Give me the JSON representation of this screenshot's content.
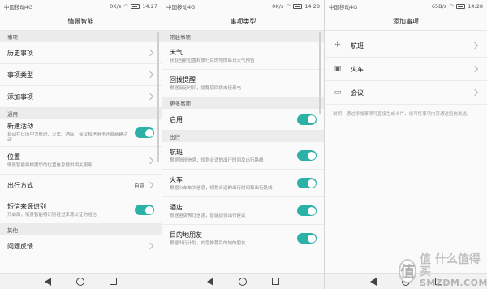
{
  "panels": [
    {
      "status": {
        "carrier": "中国移动4G",
        "speed": "0K/s",
        "time": "14:27",
        "battery_level": 0.75
      },
      "title": "情景智能",
      "sections": [
        {
          "header": "事项",
          "rows": [
            {
              "label": "历史事项",
              "control": "chevron"
            },
            {
              "label": "事项类型",
              "control": "chevron"
            },
            {
              "label": "添加事项",
              "control": "chevron"
            }
          ]
        },
        {
          "header": "通用",
          "rows": [
            {
              "label": "新建活动",
              "sub": "自动在日历中为航班、火车、酒店、会议和信用卡还款新建活动",
              "control": "toggle",
              "on": true
            },
            {
              "label": "位置",
              "sub": "情景智能将根据您的位置信息提供相关服务",
              "control": "chevron"
            },
            {
              "label": "出行方式",
              "value": "自驾",
              "control": "chevron"
            },
            {
              "label": "短信来源识别",
              "sub": "开启后，情景智能将识别经过来源认证的短信",
              "control": "toggle",
              "on": true
            }
          ]
        },
        {
          "header": "其他",
          "rows": [
            {
              "label": "问题反馈",
              "control": "chevron"
            }
          ]
        }
      ]
    },
    {
      "status": {
        "carrier": "中国移动4G",
        "speed": "0K/s",
        "time": "14:28",
        "battery_level": 0.75
      },
      "title": "事项类型",
      "sections": [
        {
          "header": "常驻事项",
          "rows": [
            {
              "label": "天气",
              "sub": "获取当前位置和旅行目的地的每日天气预告",
              "control": "none"
            },
            {
              "label": "回拨提醒",
              "sub": "根据设定时间，提醒您回拨未接来电",
              "control": "none"
            }
          ]
        },
        {
          "header": "更多事项",
          "rows": [
            {
              "label": "启用",
              "control": "toggle",
              "on": true
            }
          ]
        },
        {
          "header": "出行",
          "rows": [
            {
              "label": "航班",
              "sub": "根据航班信息，规划合适的出行时间及出行路线",
              "control": "toggle",
              "on": true
            },
            {
              "label": "火车",
              "sub": "根据火车车次信息，规划合适的出行时间和出行路线",
              "control": "toggle",
              "on": true
            },
            {
              "label": "酒店",
              "sub": "根据酒店预订信息，智能提供出行建议",
              "control": "toggle",
              "on": true
            },
            {
              "label": "目的地朋友",
              "sub": "根据出行计划，向您推荐目的地的朋友",
              "control": "toggle",
              "on": true
            }
          ]
        }
      ]
    },
    {
      "status": {
        "carrier": "中国移动4G",
        "speed": "65B/s",
        "time": "14:28",
        "battery_level": 0.75
      },
      "title": "添加事项",
      "items": [
        {
          "label": "航班",
          "icon": "airplane-icon",
          "glyph": "✈"
        },
        {
          "label": "火车",
          "icon": "train-icon",
          "glyph": "🚆"
        },
        {
          "label": "会议",
          "icon": "meeting-icon",
          "glyph": "🖥"
        }
      ],
      "note": "说明：通过添加事项可直接生成卡片，也可将事项内容通过短信发送。"
    }
  ],
  "watermark": {
    "cn": "值 什么值得买",
    "en": "SMZDM.COM",
    "logo_char": "值"
  },
  "colors": {
    "accent": "#2bb1a5",
    "section_bg": "#ececec",
    "row_bg": "#fafafa"
  }
}
